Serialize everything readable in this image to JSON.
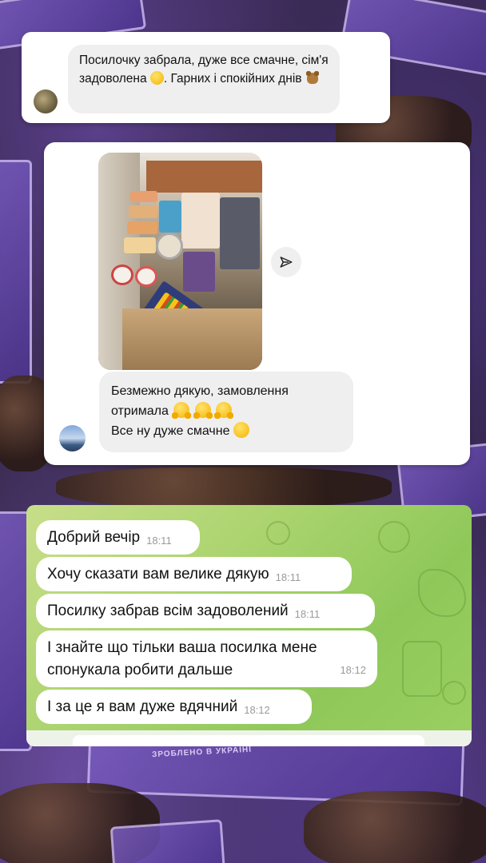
{
  "card1": {
    "message_text": "Посилочку забрала, дуже все смачне, сім'я задоволена",
    "message_text_2": ". Гарних і спокійних днів",
    "emoji_1": "smiling-face-emoji",
    "emoji_2": "teddy-bear-emoji"
  },
  "card2": {
    "photo": "parcel-contents-photo",
    "share_icon": "share-arrow-icon",
    "message_line_1": "Безмежно дякую, замовлення",
    "message_line_2": "отримала",
    "message_line_3": "Все ну дуже смачне",
    "emoji_hug": "hugging-face-emoji",
    "emoji_smile": "smiling-face-emoji"
  },
  "telegram": {
    "messages": [
      {
        "text": "Добрий вечір",
        "time": "18:11"
      },
      {
        "text": "Хочу сказати вам велике дякую",
        "time": "18:11"
      },
      {
        "text": "Посилку забрав всім задоволений",
        "time": "18:11"
      },
      {
        "text_line_1": "І знайте що тільки ваша посилка мене",
        "text_line_2": "спонукала робити дальше",
        "time": "18:12"
      },
      {
        "text": "І за це я вам дуже вдячний",
        "time": "18:12"
      }
    ]
  },
  "background": {
    "stamp_text": "ЗРОБЛЕНО В УКРАЇНІ"
  },
  "colors": {
    "card_bg": "#ffffff",
    "gray_bubble": "#efefef",
    "telegram_wallpaper": "#a9d36d",
    "background_purple": "#5a3f8a"
  }
}
